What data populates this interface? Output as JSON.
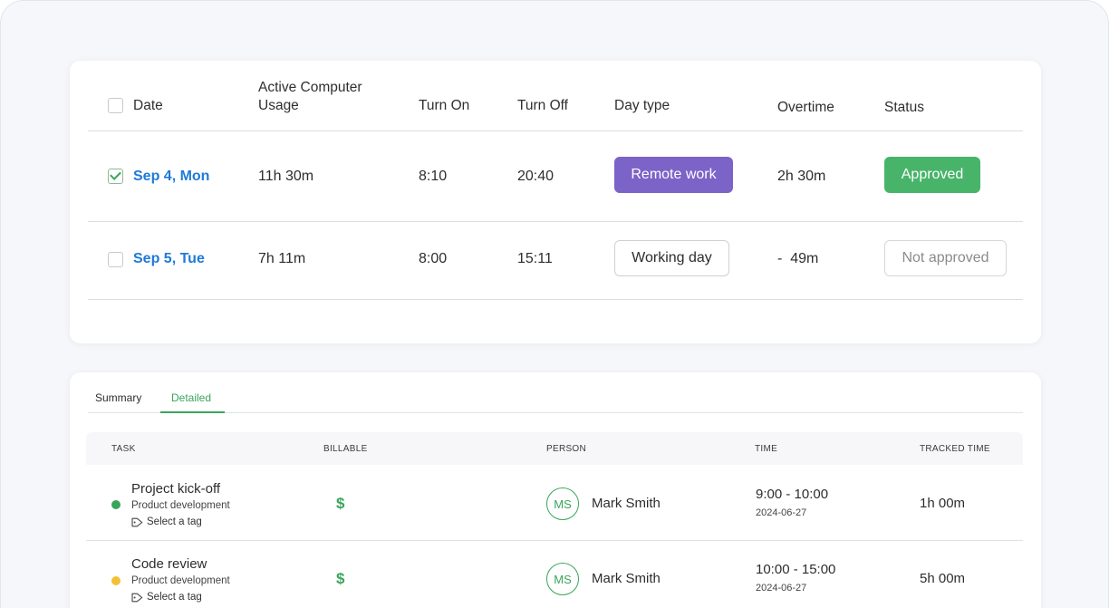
{
  "attendance": {
    "headers": {
      "date": "Date",
      "usage_line1": "Active Computer",
      "usage_line2": "Usage",
      "turn_on": "Turn On",
      "turn_off": "Turn Off",
      "day_type": "Day type",
      "overtime": "Overtime",
      "status": "Status"
    },
    "rows": [
      {
        "checked": true,
        "date": "Sep 4, Mon",
        "usage": "11h 30m",
        "turn_on": "8:10",
        "turn_off": "20:40",
        "day_type": "Remote work",
        "overtime": "2h 30m",
        "status": "Approved"
      },
      {
        "checked": false,
        "date": "Sep 5, Tue",
        "usage": "7h 11m",
        "turn_on": "8:00",
        "turn_off": "15:11",
        "day_type": "Working day",
        "overtime": "-  49m",
        "status": "Not approved"
      }
    ]
  },
  "tasks": {
    "tabs": [
      {
        "label": "Summary",
        "active": false
      },
      {
        "label": "Detailed",
        "active": true
      }
    ],
    "headers": {
      "task": "TASK",
      "billable": "BILLABLE",
      "person": "PERSON",
      "time": "TIME",
      "tracked": "TRACKED TIME"
    },
    "rows": [
      {
        "status_color": "#3aa55a",
        "name": "Project kick-off",
        "project": "Product development",
        "tag": "Select a tag",
        "billable_symbol": "$",
        "avatar_initials": "MS",
        "person": "Mark Smith",
        "time_range": "9:00 - 10:00",
        "date": "2024-06-27",
        "tracked": "1h 00m"
      },
      {
        "status_color": "#f2c037",
        "name": "Code review",
        "project": "Product development",
        "tag": "Select a tag",
        "billable_symbol": "$",
        "avatar_initials": "MS",
        "person": "Mark Smith",
        "time_range": "10:00 - 15:00",
        "date": "2024-06-27",
        "tracked": "5h 00m"
      }
    ]
  },
  "colors": {
    "accent_green": "#3aa55a",
    "remote_purple": "#7c63c8",
    "approved_green": "#48b46a",
    "link_blue": "#1f7ad8"
  }
}
